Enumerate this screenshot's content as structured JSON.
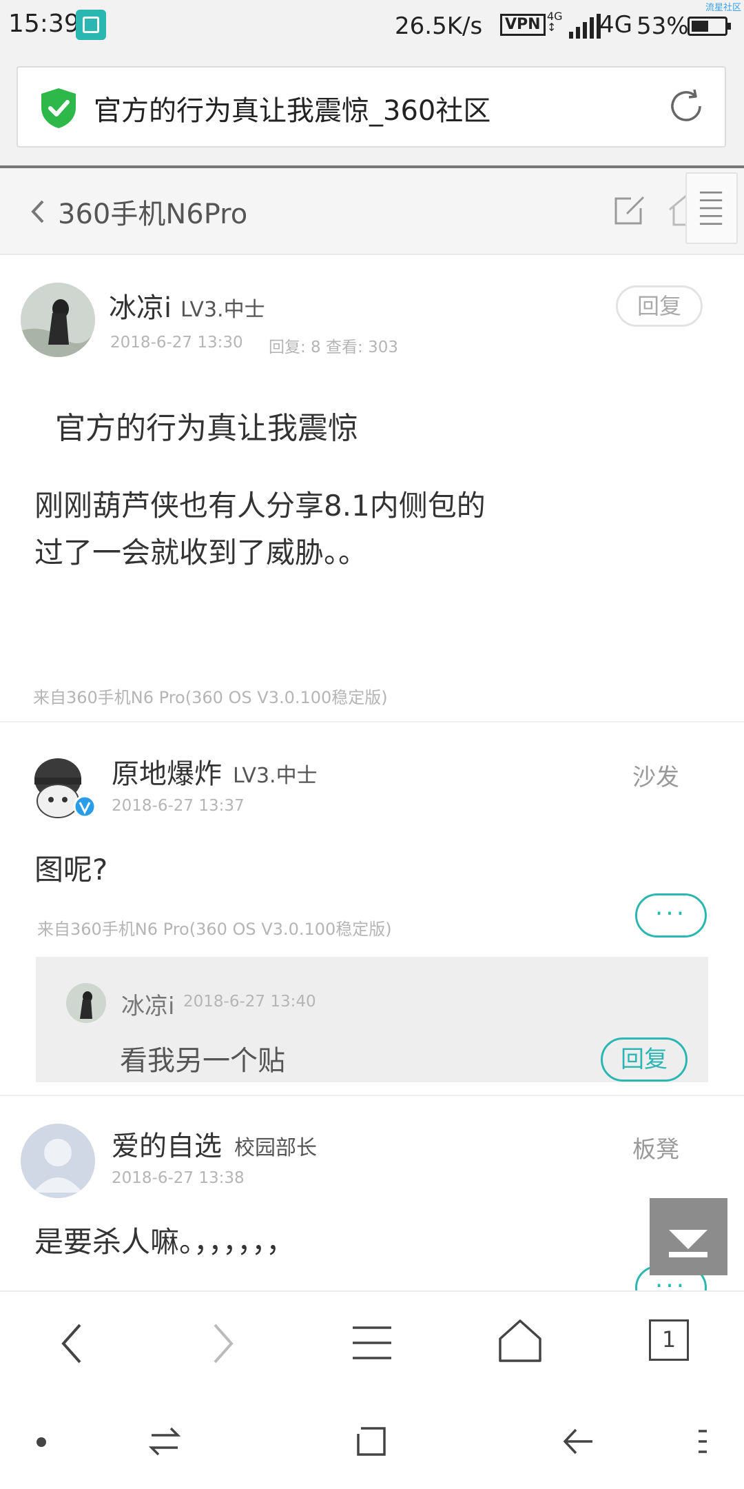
{
  "status_bar": {
    "time": "15:39",
    "speed": "26.5K/s",
    "vpn": "VPN",
    "signal_small": "4G",
    "network": "4G",
    "battery": "53%",
    "battery_level": 0.53,
    "corner_label": "流星社区"
  },
  "url_bar": {
    "title": "官方的行为真让我震惊_360社区",
    "secure_icon": "shield-check-icon",
    "refresh_icon": "refresh-icon"
  },
  "forum_header": {
    "name": "360手机N6Pro"
  },
  "post": {
    "author": "冰凉i",
    "level": "LV3.中士",
    "date": "2018-6-27 13:30",
    "stats": "回复: 8 查看: 303",
    "reply_label": "回复",
    "title": "官方的行为真让我震惊",
    "body_line1": "刚刚葫芦侠也有人分享8.1内侧包的",
    "body_line2": "过了一会就收到了威胁。。",
    "source": "来自360手机N6 Pro(360 OS V3.0.100稳定版)"
  },
  "replies": [
    {
      "author": "原地爆炸",
      "level": "LV3.中士",
      "date": "2018-6-27 13:37",
      "floor": "沙发",
      "content": "图呢?",
      "source": "来自360手机N6 Pro(360 OS V3.0.100稳定版)",
      "more": "···",
      "sub": {
        "author": "冰凉i",
        "date": "2018-6-27 13:40",
        "content": "看我另一个贴",
        "reply_label": "回复"
      }
    },
    {
      "author": "爱的自选",
      "level": "校园部长",
      "date": "2018-6-27 13:38",
      "floor": "板凳",
      "content": "是要杀人嘛。，，，，，，",
      "more": "···"
    }
  ],
  "toolbar": {
    "tab_count": "1"
  },
  "colors": {
    "accent": "#2ab7b2",
    "shield": "#2eb84a"
  }
}
